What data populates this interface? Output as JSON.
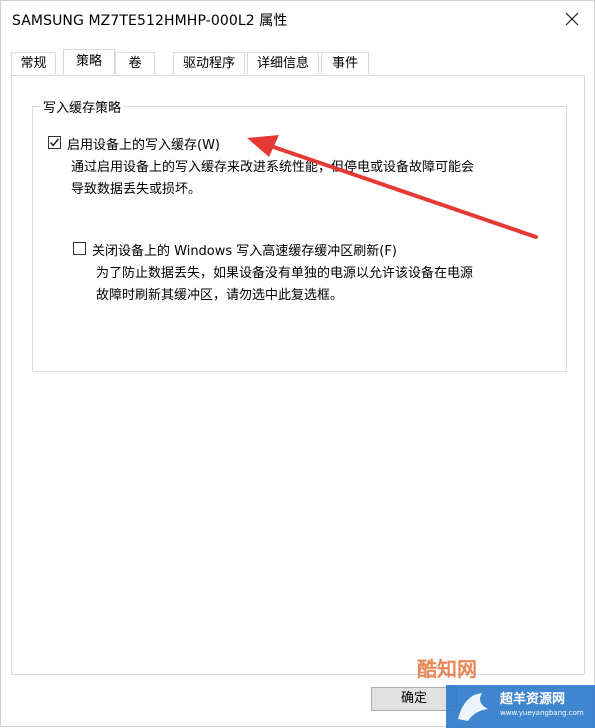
{
  "window": {
    "title": "SAMSUNG MZ7TE512HMHP-000L2 属性"
  },
  "tabs": [
    {
      "label": "常规"
    },
    {
      "label": "策略",
      "active": true
    },
    {
      "label": "卷"
    },
    {
      "label": "驱动程序"
    },
    {
      "label": "详细信息"
    },
    {
      "label": "事件"
    }
  ],
  "policy": {
    "group_title": "写入缓存策略",
    "enable_cache": {
      "label": "启用设备上的写入缓存(W)",
      "checked": true,
      "description_line1": "通过启用设备上的写入缓存来改进系统性能，但停电或设备故障可能会",
      "description_line2": "导致数据丢失或损坏。"
    },
    "disable_flush": {
      "label": "关闭设备上的 Windows 写入高速缓存缓冲区刷新(F)",
      "checked": false,
      "description_line1": "为了防止数据丢失，如果设备没有单独的电源以允许该设备在电源",
      "description_line2": "故障时刷新其缓冲区，请勿选中此复选框。"
    }
  },
  "buttons": {
    "ok": "确定"
  },
  "watermark": {
    "brand": "酷知网",
    "site_name": "超羊资源网",
    "site_url": "www.yueyangbang.com"
  },
  "annotation_color": "#e53935"
}
